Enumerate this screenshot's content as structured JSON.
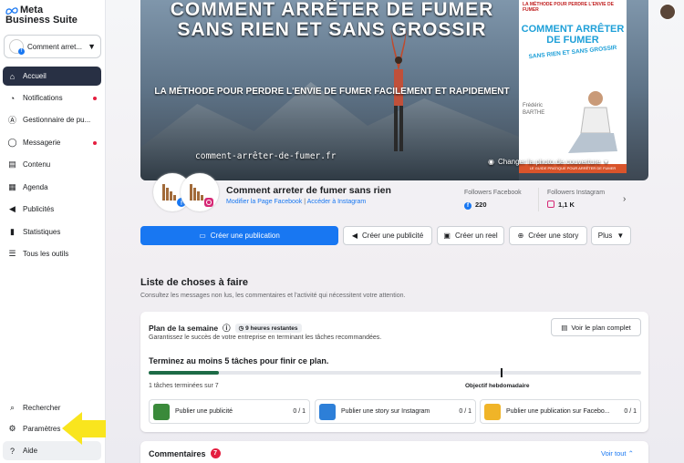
{
  "app": {
    "logo_line1": "Meta",
    "logo_line2": "Business Suite"
  },
  "account": {
    "name": "Comment arret..."
  },
  "sidebar": {
    "items": [
      {
        "label": "Accueil",
        "icon": "home-icon",
        "glyph": "⌂"
      },
      {
        "label": "Notifications",
        "icon": "bell-icon",
        "glyph": "🔔︎"
      },
      {
        "label": "Gestionnaire de pu...",
        "icon": "ad-manager-icon",
        "glyph": "Ⓐ"
      },
      {
        "label": "Messagerie",
        "icon": "chat-icon",
        "glyph": "◯"
      },
      {
        "label": "Contenu",
        "icon": "content-icon",
        "glyph": "▤"
      },
      {
        "label": "Agenda",
        "icon": "calendar-icon",
        "glyph": "▦"
      },
      {
        "label": "Publicités",
        "icon": "megaphone-icon",
        "glyph": "◀"
      },
      {
        "label": "Statistiques",
        "icon": "chart-icon",
        "glyph": "▮"
      },
      {
        "label": "Tous les outils",
        "icon": "menu-icon",
        "glyph": "☰"
      }
    ],
    "bottom": [
      {
        "label": "Rechercher",
        "icon": "search-icon",
        "glyph": "⌕"
      },
      {
        "label": "Paramètres",
        "icon": "gear-icon",
        "glyph": "⚙"
      },
      {
        "label": "Aide",
        "icon": "help-icon",
        "glyph": "?"
      }
    ]
  },
  "cover": {
    "title": "COMMENT ARRÊTER DE FUMER SANS RIEN ET SANS GROSSIR",
    "subtitle": "LA MÉTHODE POUR PERDRE L'ENVIE DE FUMER FACILEMENT ET RAPIDEMENT",
    "url": "comment-arrêter-de-fumer.fr",
    "book_top": "LA MÉTHODE POUR PERDRE L'ENVIE DE FUMER",
    "book_title": "COMMENT ARRÊTER DE FUMER",
    "book_sub": "SANS RIEN ET SANS GROSSIR",
    "book_author_first": "Frédéric",
    "book_author_last": "BARTHE",
    "book_bottom": "LE GUIDE PRATIQUE POUR ARRÊTER DE FUMER",
    "change_label": "Changer la photo de couverture"
  },
  "page": {
    "name": "Comment arreter de fumer sans rien",
    "link_fb": "Modifier la Page Facebook",
    "sep": " | ",
    "link_ig": "Accéder à Instagram",
    "fb_followers_label": "Followers Facebook",
    "fb_followers_value": "220",
    "ig_followers_label": "Followers Instagram",
    "ig_followers_value": "1,1 K"
  },
  "actions": {
    "create_post": "Créer une publication",
    "create_ad": "Créer une publicité",
    "create_reel": "Créer un reel",
    "create_story": "Créer une story",
    "more": "Plus"
  },
  "todo": {
    "title": "Liste de choses à faire",
    "subtitle": "Consultez les messages non lus, les commentaires et l'activité qui nécessitent votre attention."
  },
  "plan": {
    "title": "Plan de la semaine",
    "badge": "9 heures restantes",
    "subtitle": "Garantissez le succès de votre entreprise en terminant les tâches recommandées.",
    "view_full": "Voir le plan complet",
    "goal": "Terminez au moins 5 tâches pour finir ce plan.",
    "progress_fraction": 0.143,
    "weekly_goal_fraction": 0.714,
    "done_text": "1 tâches terminées sur 7",
    "objective_label": "Objectif hebdomadaire",
    "tasks": [
      {
        "label": "Publier une publicité",
        "count": "0 / 1",
        "color": "#3a8a3a"
      },
      {
        "label": "Publier une story sur Instagram",
        "count": "0 / 1",
        "color": "#2d7fd8"
      },
      {
        "label": "Publier une publication sur Facebo...",
        "count": "0 / 1",
        "color": "#f0b428"
      }
    ]
  },
  "comments": {
    "title": "Commentaires",
    "badge": "7",
    "view_all": "Voir tout"
  },
  "colors": {
    "accent": "#1877f2",
    "active_nav": "#283044",
    "arrow": "#f9e51e",
    "progress": "#1d6b46"
  }
}
